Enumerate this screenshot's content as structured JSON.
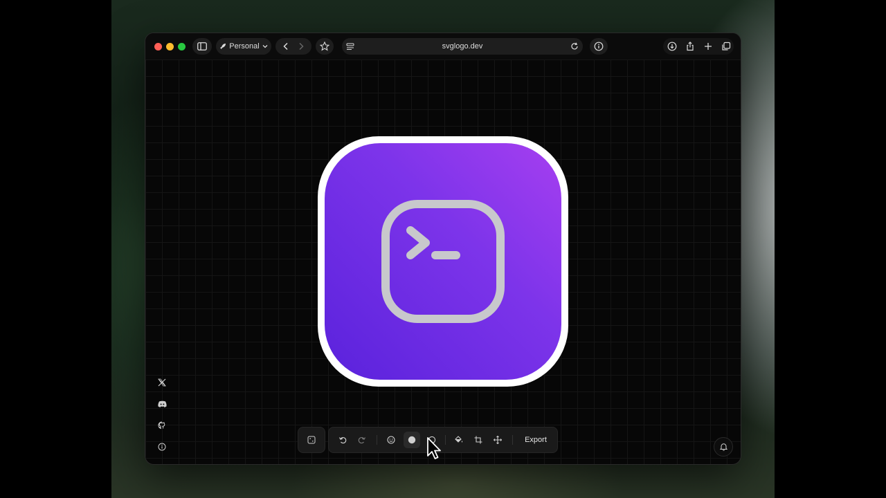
{
  "browser": {
    "profile_label": "Personal",
    "url": "svglogo.dev"
  },
  "logo": {
    "gradient_start": "#a63ff0",
    "gradient_end": "#5a22dc",
    "border_color": "#ffffff",
    "glyph_color": "#c8c8cc",
    "icon": "terminal-square-icon"
  },
  "sidebar_links": [
    {
      "icon": "x-icon"
    },
    {
      "icon": "discord-icon"
    },
    {
      "icon": "github-icon"
    },
    {
      "icon": "info-icon"
    }
  ],
  "toolbar": {
    "export_label": "Export",
    "tools": [
      "undo-icon",
      "redo-icon",
      "smiley-icon",
      "fill-circle-icon",
      "stroke-circle-icon",
      "paint-bucket-icon",
      "crop-icon",
      "move-icon"
    ]
  }
}
